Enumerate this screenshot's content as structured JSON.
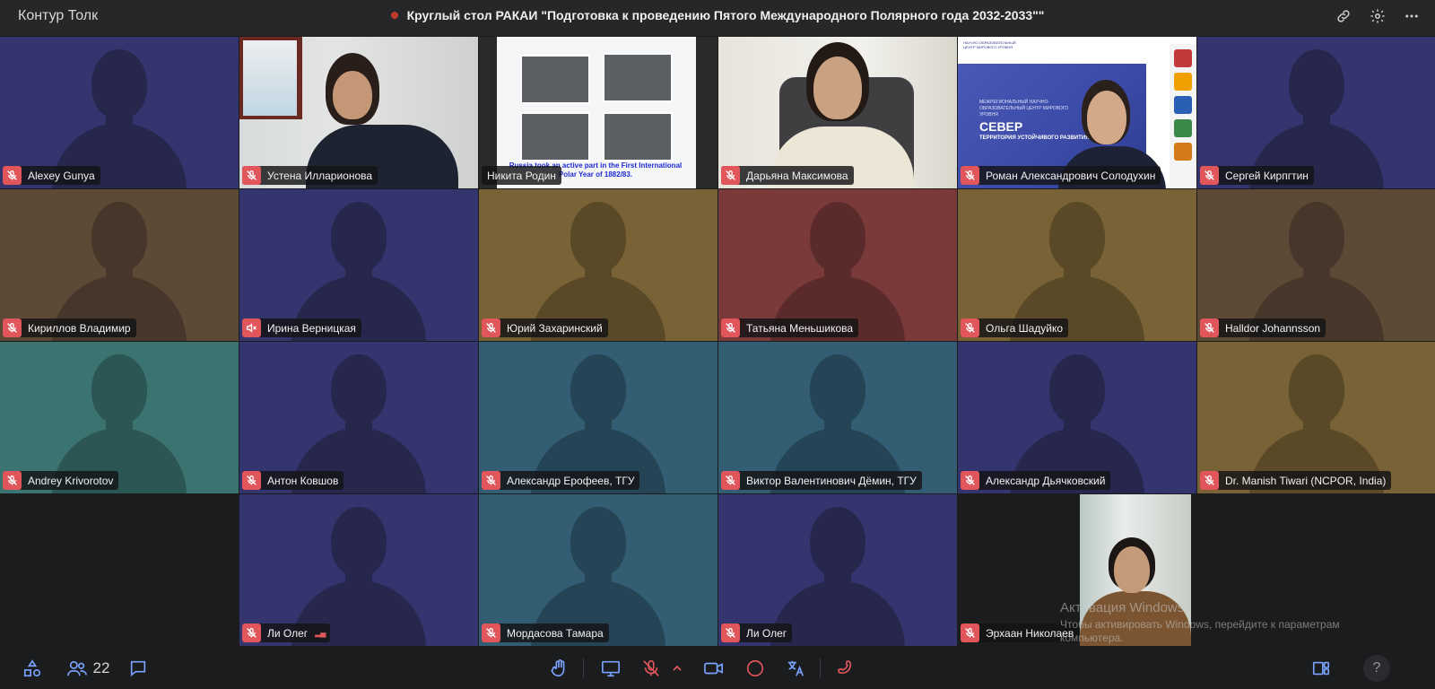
{
  "app": {
    "name": "Контур Толк"
  },
  "meeting": {
    "title": "Круглый стол РАКАИ \"Подготовка к проведению Пятого Международного Полярного года 2032-2033\"\"",
    "recording": true
  },
  "top_actions": [
    "link-icon",
    "settings-icon",
    "more-icon"
  ],
  "participants": [
    {
      "name": "Alexey Gunya",
      "bg": "#34346e",
      "fg": "#27274e",
      "mic": "muted"
    },
    {
      "name": "Устена Илларионова",
      "video": "office",
      "mic": "muted"
    },
    {
      "name": "Никита Родин",
      "video": "slide",
      "mic": "none"
    },
    {
      "name": "Дарьяна Максимова",
      "video": "room",
      "mic": "muted"
    },
    {
      "name": "Роман Александрович Солодухин",
      "video": "brand",
      "mic": "muted"
    },
    {
      "name": "Сергей Кирпгтин",
      "bg": "#34346e",
      "fg": "#27274e",
      "mic": "muted"
    },
    {
      "name": "Кириллов Владимир",
      "bg": "#5c4a36",
      "fg": "#46372a",
      "mic": "muted"
    },
    {
      "name": "Ирина Верницкая",
      "bg": "#34346e",
      "fg": "#27274e",
      "mic": "speaker-muted"
    },
    {
      "name": "Юрий Захаринский",
      "bg": "#786236",
      "fg": "#5a4927",
      "mic": "muted"
    },
    {
      "name": "Татьяна Меньшикова",
      "bg": "#7a3a3a",
      "fg": "#5b2b2b",
      "mic": "muted"
    },
    {
      "name": "Ольга Шадуйко",
      "bg": "#786236",
      "fg": "#5a4927",
      "mic": "muted"
    },
    {
      "name": "Halldor Johannsson",
      "bg": "#5c4a36",
      "fg": "#46372a",
      "mic": "muted"
    },
    {
      "name": "Andrey Krivorotov",
      "bg": "#3b7370",
      "fg": "#2c5654",
      "mic": "muted"
    },
    {
      "name": "Антон Ковшов",
      "bg": "#34346e",
      "fg": "#27274e",
      "mic": "muted"
    },
    {
      "name": "Александр Ерофеев, ТГУ",
      "bg": "#325d73",
      "fg": "#254556",
      "mic": "muted"
    },
    {
      "name": "Виктор Валентинович Дёмин, ТГУ",
      "bg": "#325d73",
      "fg": "#254556",
      "mic": "muted"
    },
    {
      "name": "Александр Дьячковский",
      "bg": "#34346e",
      "fg": "#27274e",
      "mic": "muted"
    },
    {
      "name": "Dr. Manish Tiwari (NCPOR, India)",
      "bg": "#786236",
      "fg": "#5a4927",
      "mic": "muted"
    },
    {
      "empty": true
    },
    {
      "name": "Ли Олег",
      "bg": "#34346e",
      "fg": "#27274e",
      "mic": "muted",
      "signal": true
    },
    {
      "name": "Мордасова Тамара",
      "bg": "#325d73",
      "fg": "#254556",
      "mic": "muted"
    },
    {
      "name": "Ли Олег",
      "bg": "#34346e",
      "fg": "#27274e",
      "mic": "muted"
    },
    {
      "name": "Эрхаан Николаев",
      "video": "guy",
      "mic": "muted"
    },
    {
      "empty": true
    }
  ],
  "slide": {
    "caption": "Russia took an active part in the First International Polar Year of 1882/83."
  },
  "brand": {
    "headline": "СЕВЕР",
    "subline": "ТЕРРИТОРИЯ УСТОЙЧИВОГО РАЗВИТИЯ",
    "center": "МЕЖРЕГИОНАЛЬНЫЙ НАУЧНО-ОБРАЗОВАТЕЛЬНЫЙ ЦЕНТР МИРОВОГО УРОВНЯ",
    "toplogo": "НАУЧНО-ОБРАЗОВАТЕЛЬНЫЙ ЦЕНТР МИРОВОГО УРОВНЯ"
  },
  "watermark": {
    "title": "Активация Windows",
    "text": "Чтобы активировать Windows, перейдите к параметрам компьютера."
  },
  "bottom": {
    "participants_count": "22",
    "help": "?"
  }
}
